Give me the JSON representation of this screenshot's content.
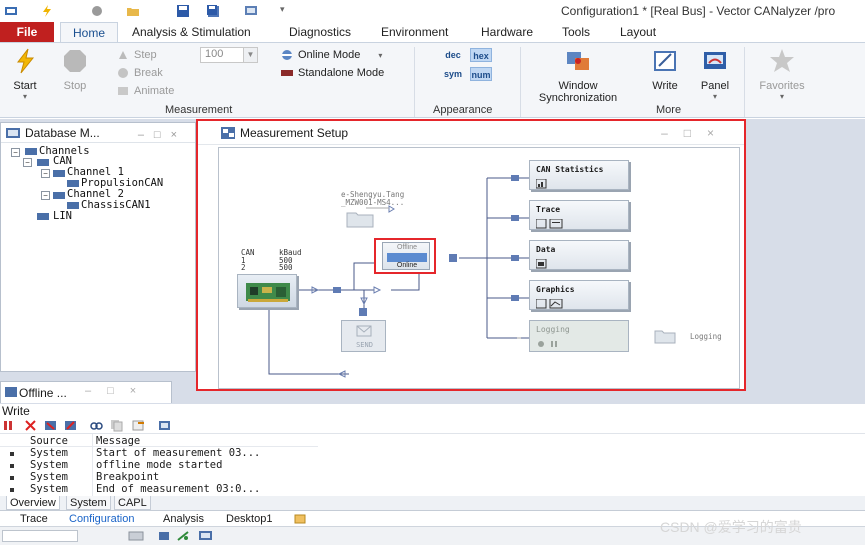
{
  "window_title": "Configuration1 * [Real Bus] - Vector CANalyzer /pro",
  "ribbon_tabs": [
    "File",
    "Home",
    "Analysis & Stimulation",
    "Diagnostics",
    "Environment",
    "Hardware",
    "Tools",
    "Layout"
  ],
  "measurement": {
    "start": "Start",
    "stop": "Stop",
    "step": "Step",
    "break": "Break",
    "animate": "Animate",
    "speed_value": "100",
    "online_mode": "Online Mode",
    "standalone_mode": "Standalone Mode",
    "group_label": "Measurement"
  },
  "appearance": {
    "dec": "dec",
    "hex": "hex",
    "sym": "sym",
    "num": "num",
    "group_label": "Appearance"
  },
  "more": {
    "window_sync": "Window Synchronization",
    "write": "Write",
    "panel": "Panel",
    "favorites": "Favorites",
    "group_label": "More"
  },
  "database_panel": {
    "title": "Database M...",
    "tree": [
      "Channels",
      "CAN",
      "Channel 1",
      "PropulsionCAN",
      "Channel 2",
      "ChassisCAN1",
      "LIN"
    ]
  },
  "measurement_setup": {
    "title": "Measurement Setup",
    "can_table": {
      "h1": "CAN",
      "h2": "kBaud",
      "r1c1": "1",
      "r1c2": "500",
      "r2c1": "2",
      "r2c2": "500"
    },
    "file_label_1": "e-Shengyu.Tang",
    "file_label_2": "_MZW001-MS4...",
    "switch_top": "Offline",
    "switch_bottom": "Online",
    "send_label": "SEND",
    "blocks": [
      "CAN Statistics",
      "Trace",
      "Data",
      "Graphics",
      "Logging"
    ],
    "logging_file": "Logging"
  },
  "offline_panel": {
    "title": "Offline ..."
  },
  "write_window": {
    "label": "Write",
    "headers": {
      "source": "Source",
      "message": "Message"
    },
    "rows": [
      {
        "source": "System",
        "message": "Start of measurement 03..."
      },
      {
        "source": "System",
        "message": "offline mode started"
      },
      {
        "source": "System",
        "message": "Breakpoint"
      },
      {
        "source": "System",
        "message": "End of measurement 03:0..."
      }
    ],
    "tabs": [
      "Overview",
      "System",
      "CAPL"
    ]
  },
  "bottom_tabs": [
    "Trace",
    "Configuration",
    "Analysis",
    "Desktop1"
  ],
  "watermark": "CSDN @爱学习的富贵",
  "colors": {
    "accent": "#1a4f8f",
    "file_tab": "#c0201f",
    "highlight_border": "#e5262b"
  }
}
